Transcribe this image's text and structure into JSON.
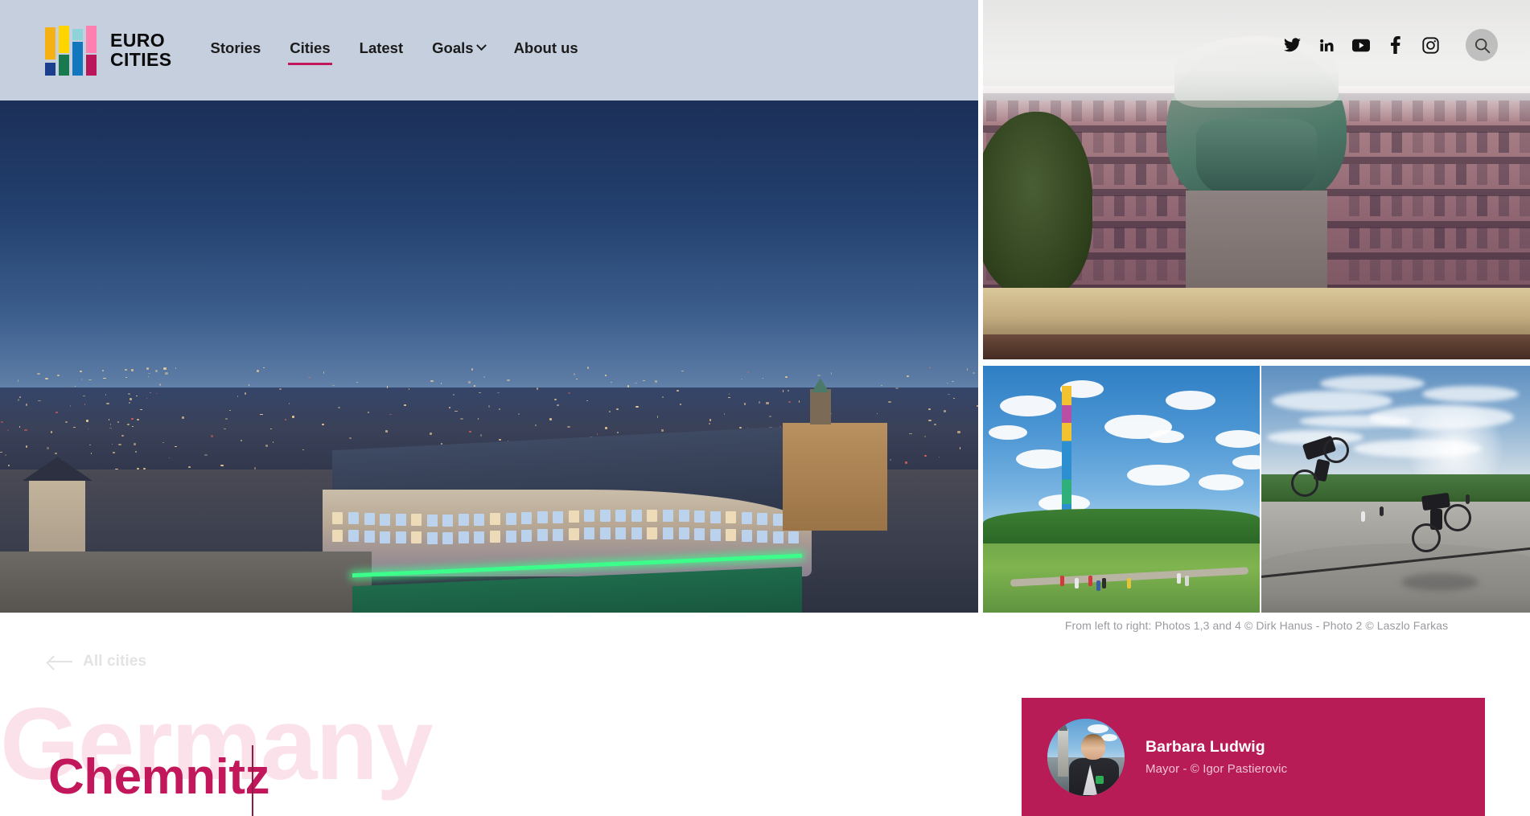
{
  "brand": {
    "name_line1": "EURO",
    "name_line2": "CITIES",
    "logo_colors": [
      "#f5b013",
      "#ffd500",
      "#8dd3d8",
      "#ff7fae",
      "#1a7a4f",
      "#1277bc",
      "#1b3f8c",
      "#b8175a"
    ]
  },
  "nav": {
    "items": [
      {
        "label": "Stories",
        "active": false,
        "has_dropdown": false
      },
      {
        "label": "Cities",
        "active": true,
        "has_dropdown": false
      },
      {
        "label": "Latest",
        "active": false,
        "has_dropdown": false
      },
      {
        "label": "Goals",
        "active": false,
        "has_dropdown": true
      },
      {
        "label": "About us",
        "active": false,
        "has_dropdown": false
      }
    ],
    "active_underline_color": "#c2185b"
  },
  "social": {
    "items": [
      {
        "name": "twitter-icon",
        "label": "Twitter"
      },
      {
        "name": "linkedin-icon",
        "label": "LinkedIn"
      },
      {
        "name": "youtube-icon",
        "label": "YouTube"
      },
      {
        "name": "facebook-icon",
        "label": "Facebook"
      },
      {
        "name": "instagram-icon",
        "label": "Instagram"
      }
    ],
    "search_label": "Search"
  },
  "gallery": {
    "photos": [
      {
        "position": 1,
        "alt": "Chemnitz city centre aerial view at dusk"
      },
      {
        "position": 2,
        "alt": "Karl Marx Monument in Chemnitz at night"
      },
      {
        "position": 3,
        "alt": "Colourful Esse chimney with cyclists on green meadow"
      },
      {
        "position": 4,
        "alt": "Skatepark with BMX riders"
      }
    ],
    "credit": "From left to right: Photos 1,3 and 4 © Dirk Hanus - Photo 2 © Laszlo Farkas"
  },
  "back_link": {
    "label": "All cities",
    "icon": "arrow-left-icon"
  },
  "city": {
    "country": "Germany",
    "name": "Chemnitz",
    "country_color": "#fbe2ea",
    "name_color": "#c2185b"
  },
  "mayor": {
    "name": "Barbara Ludwig",
    "role": "Mayor - © Igor Pastierovic",
    "card_color": "#b81c56"
  }
}
